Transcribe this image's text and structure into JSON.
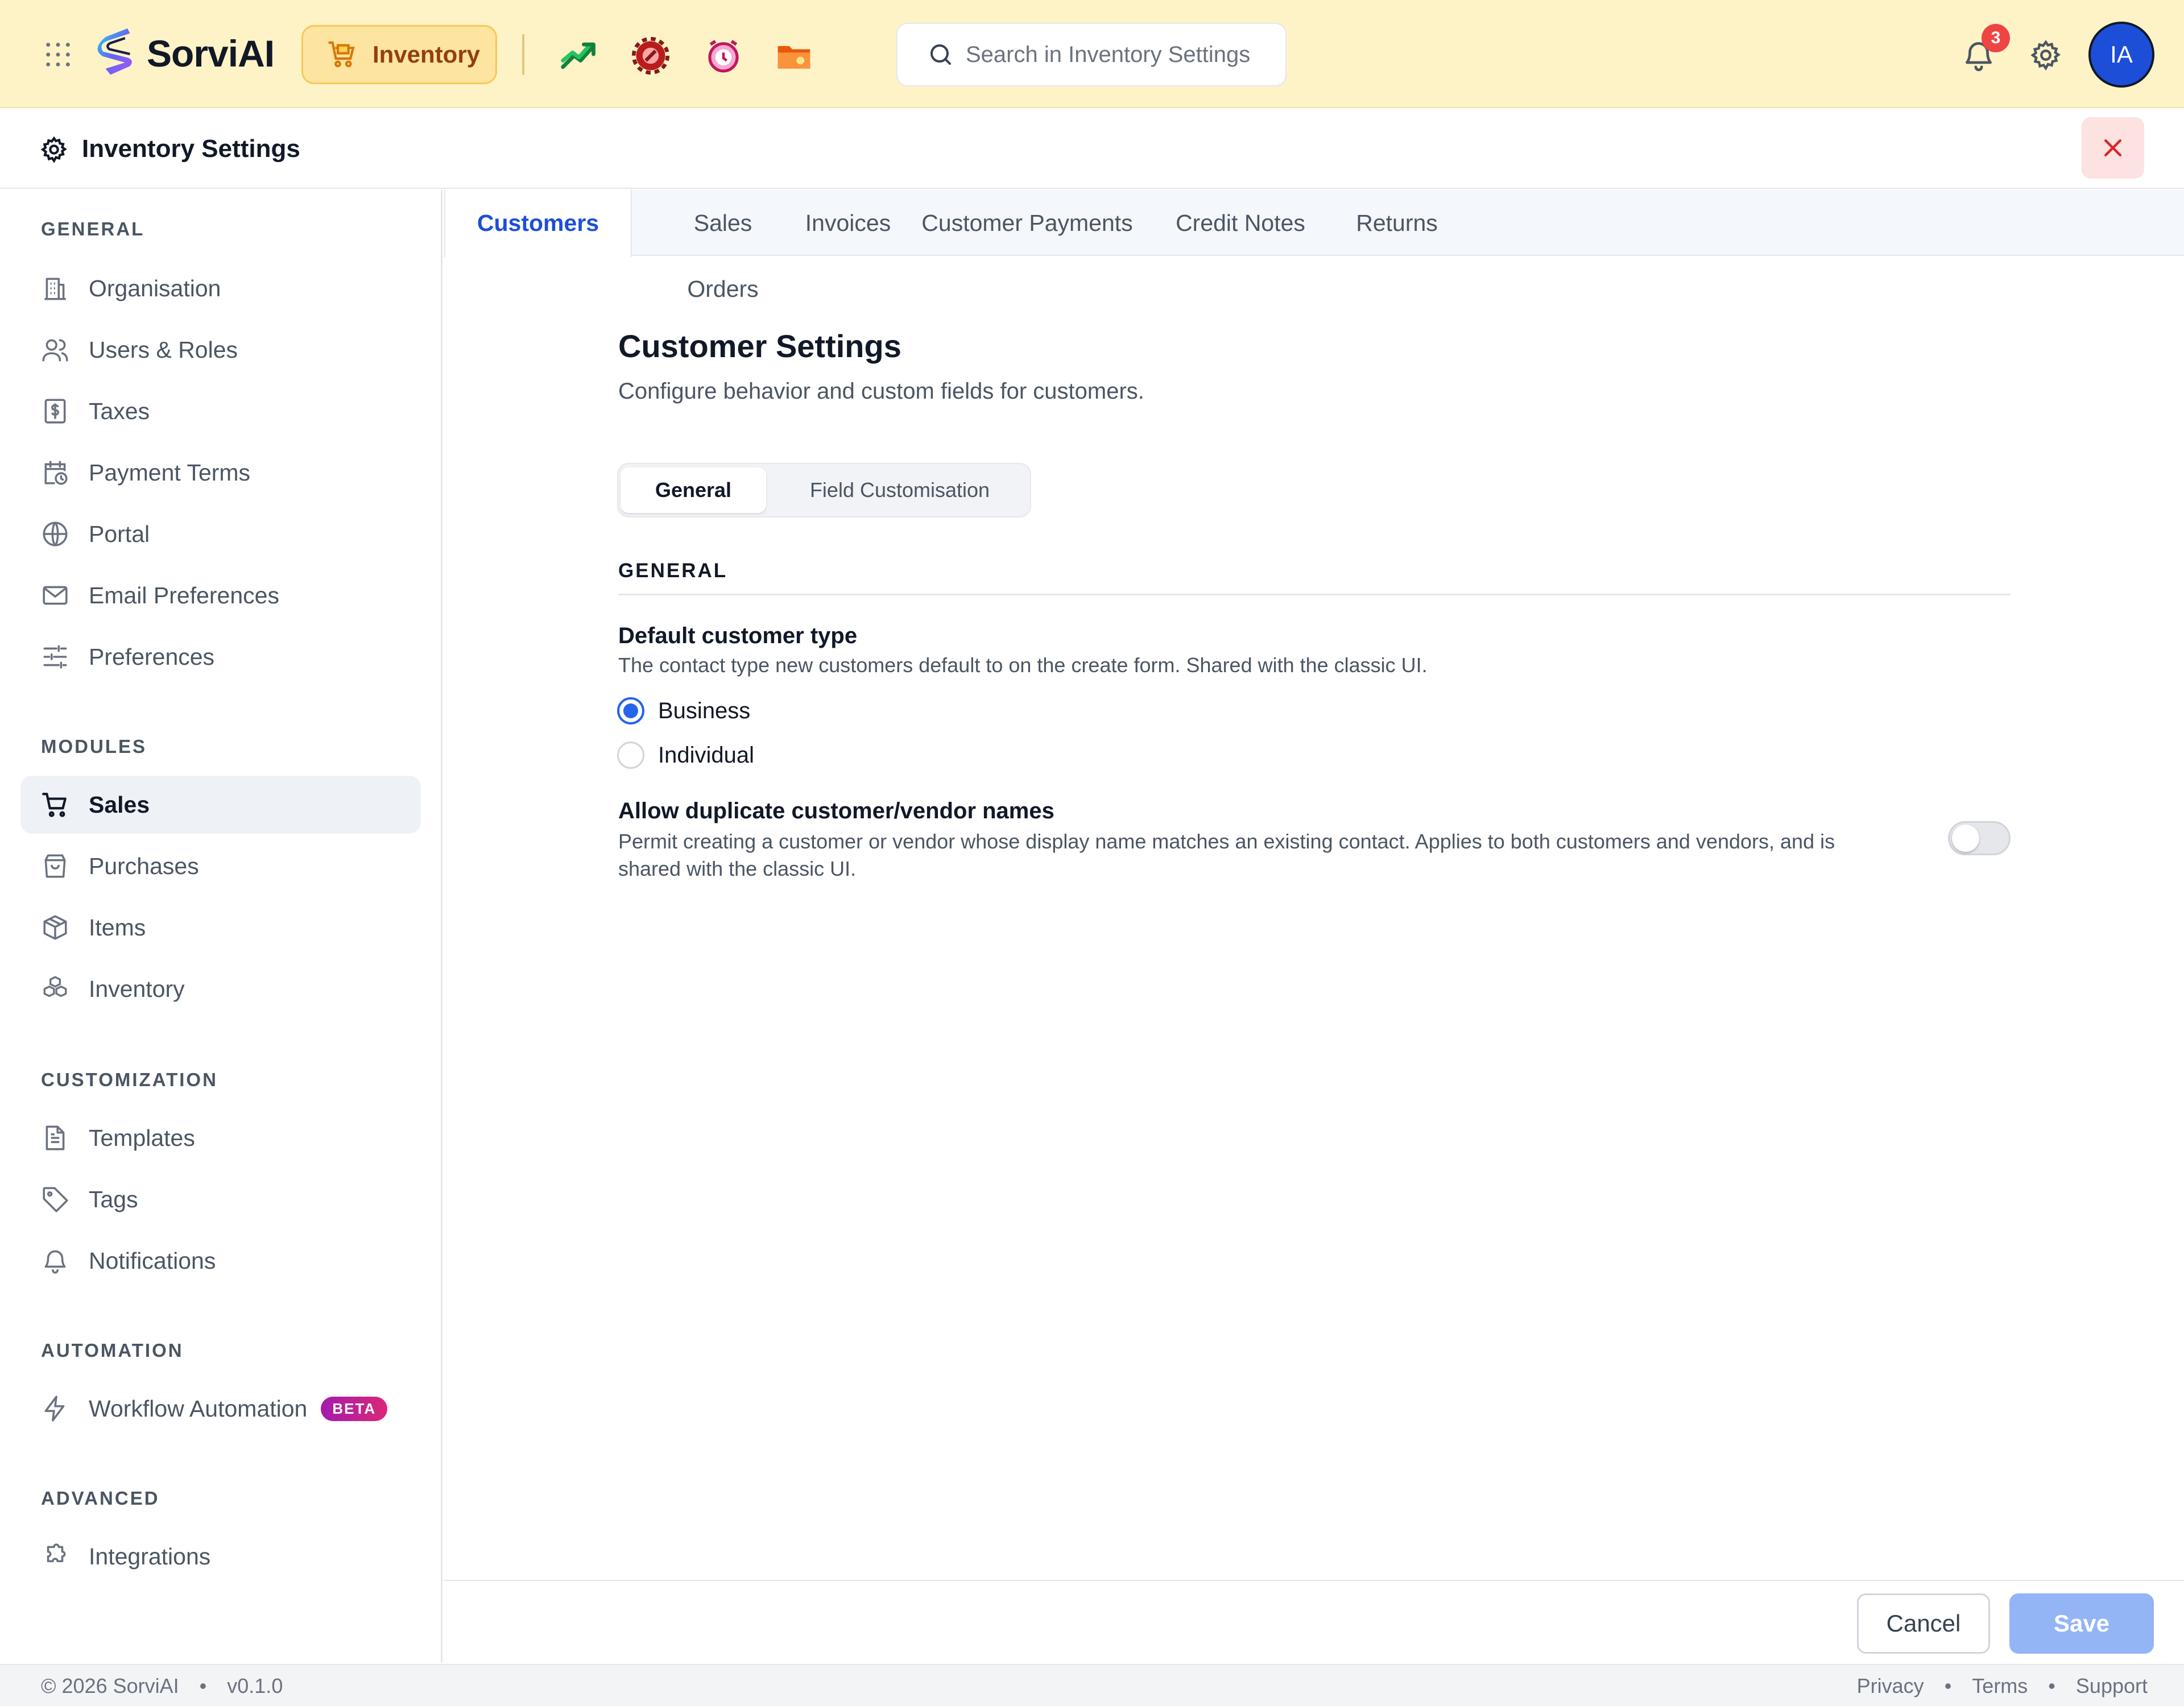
{
  "app": {
    "brand": "SorviAI",
    "module_label": "Inventory",
    "search_placeholder": "Search in Inventory Settings",
    "notification_count": "3",
    "avatar_initials": "IA",
    "quick_apps": [
      "trend-up-icon",
      "wrench-gear-icon",
      "alarm-clock-icon",
      "folder-icon"
    ]
  },
  "settings": {
    "title": "Inventory Settings"
  },
  "sidebar": {
    "sections": [
      {
        "title": "GENERAL",
        "items": [
          {
            "label": "Organisation",
            "icon": "building-icon"
          },
          {
            "label": "Users & Roles",
            "icon": "users-icon"
          },
          {
            "label": "Taxes",
            "icon": "dollar-receipt-icon"
          },
          {
            "label": "Payment Terms",
            "icon": "calendar-clock-icon"
          },
          {
            "label": "Portal",
            "icon": "globe-icon"
          },
          {
            "label": "Email Preferences",
            "icon": "mail-icon"
          },
          {
            "label": "Preferences",
            "icon": "sliders-icon"
          }
        ]
      },
      {
        "title": "MODULES",
        "items": [
          {
            "label": "Sales",
            "icon": "cart-icon",
            "active": true
          },
          {
            "label": "Purchases",
            "icon": "shopping-bag-icon"
          },
          {
            "label": "Items",
            "icon": "box-icon"
          },
          {
            "label": "Inventory",
            "icon": "boxes-icon"
          }
        ]
      },
      {
        "title": "CUSTOMIZATION",
        "items": [
          {
            "label": "Templates",
            "icon": "document-icon"
          },
          {
            "label": "Tags",
            "icon": "tag-icon"
          },
          {
            "label": "Notifications",
            "icon": "bell-icon"
          }
        ]
      },
      {
        "title": "AUTOMATION",
        "items": [
          {
            "label": "Workflow Automation",
            "icon": "lightning-icon",
            "badge": "BETA"
          }
        ]
      },
      {
        "title": "ADVANCED",
        "items": [
          {
            "label": "Integrations",
            "icon": "puzzle-icon"
          }
        ]
      }
    ]
  },
  "tabs": [
    {
      "label": "Customers",
      "active": true
    },
    {
      "label": "Sales Orders"
    },
    {
      "label": "Invoices"
    },
    {
      "label": "Customer Payments"
    },
    {
      "label": "Credit Notes"
    },
    {
      "label": "Returns"
    }
  ],
  "main": {
    "title": "Customer Settings",
    "subtitle": "Configure behavior and custom fields for customers.",
    "subtabs": [
      {
        "label": "General",
        "active": true
      },
      {
        "label": "Field Customisation"
      }
    ],
    "section_label": "GENERAL",
    "default_type": {
      "title": "Default customer type",
      "description": "The contact type new customers default to on the create form. Shared with the classic UI.",
      "options": [
        {
          "label": "Business",
          "checked": true
        },
        {
          "label": "Individual",
          "checked": false
        }
      ]
    },
    "duplicates": {
      "title": "Allow duplicate customer/vendor names",
      "description_line1": "Permit creating a customer or vendor whose display name matches an existing contact. Applies to both customers and vendors, and is",
      "description_line2": "shared with the classic UI.",
      "enabled": false
    }
  },
  "actions": {
    "cancel": "Cancel",
    "save": "Save"
  },
  "footer": {
    "copyright": "© 2026 SorviAI",
    "version": "v0.1.0",
    "links": [
      "Privacy",
      "Terms",
      "Support"
    ]
  },
  "colors": {
    "topbar_bg": "#fef3c6",
    "accent_blue": "#1d4ed8",
    "active_tab": "#1d4ed8",
    "save_disabled": "#93b4f5",
    "badge_red": "#ef4444",
    "beta_gradient": "#a21caf"
  }
}
